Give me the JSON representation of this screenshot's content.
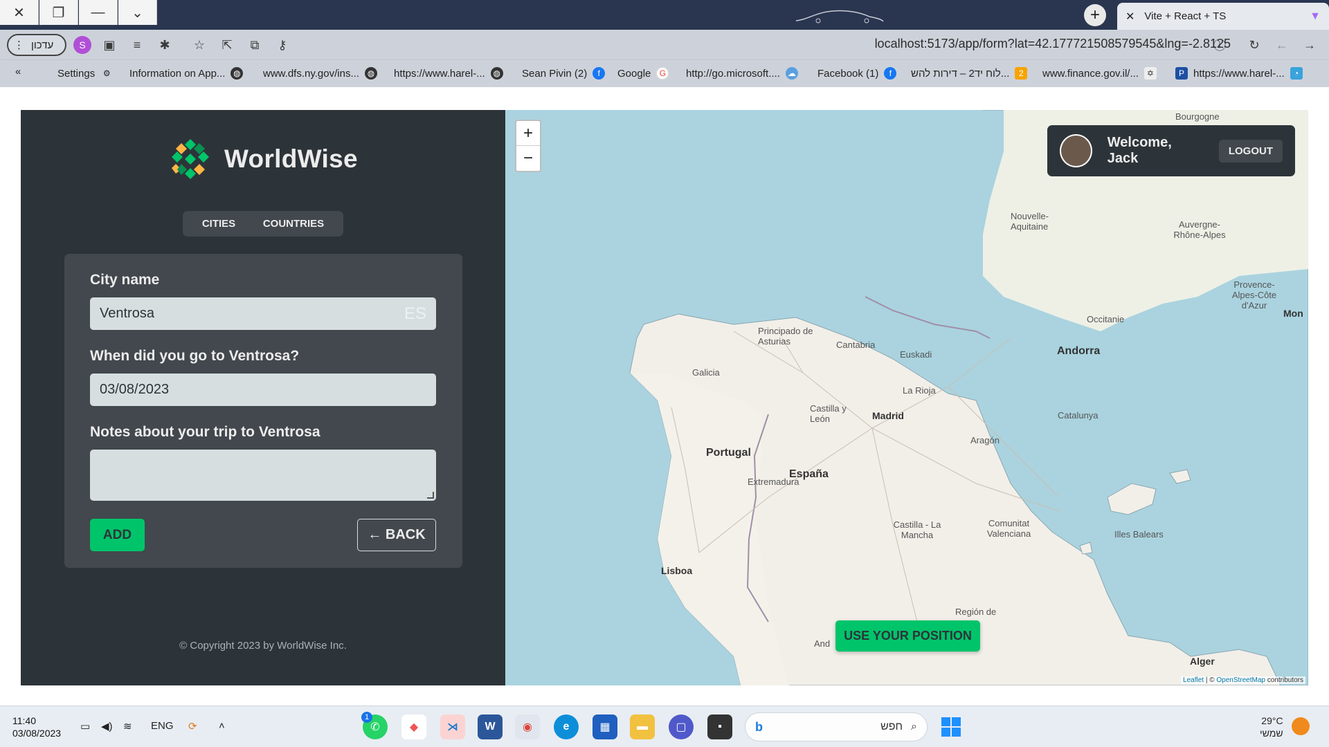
{
  "browser": {
    "window_controls": {
      "close": "✕",
      "restore": "❐",
      "minimize": "—",
      "tabs_menu": "⌄"
    },
    "tab": {
      "title": "Vite + React + TS",
      "close": "✕"
    },
    "profile_label": "עדכון",
    "avatar_letter": "S",
    "url": "localhost:5173/app/form?lat=42.177721508579545&lng=-2.8125",
    "bookmarks": [
      "Settings",
      "Information on App...",
      "www.dfs.ny.gov/ins...",
      "https://www.harel-...",
      "Sean Pivin (2)",
      "Google",
      "http://go.microsoft....",
      "Facebook (1)",
      "לוח יד2 – דירות להש...",
      "www.finance.gov.il/...",
      "https://www.harel-..."
    ]
  },
  "app": {
    "brand": "WorldWise",
    "nav": {
      "cities": "CITIES",
      "countries": "COUNTRIES"
    },
    "form": {
      "city_label": "City name",
      "city_value": "Ventrosa",
      "city_flag": "ES",
      "date_label": "When did you go to Ventrosa?",
      "date_value": "03/08/2023",
      "notes_label": "Notes about your trip to Ventrosa",
      "notes_value": "",
      "add_button": "ADD",
      "back_button": "← BACK"
    },
    "copyright": "© Copyright 2023 by WorldWise Inc."
  },
  "map": {
    "zoom_in": "+",
    "zoom_out": "−",
    "welcome": "Welcome, Jack",
    "logout": "LOGOUT",
    "use_position": "USE YOUR POSITION",
    "attribution": {
      "leaflet": "Leaflet",
      "sep": " | © ",
      "osm": "OpenStreetMap",
      "contrib": " contributors"
    },
    "labels": {
      "portugal": "Portugal",
      "espana": "España",
      "madrid": "Madrid",
      "lisboa": "Lisboa",
      "andorra": "Andorra",
      "alger": "Alger",
      "galicia": "Galicia",
      "asturias": "Principado de Asturias",
      "cantabria": "Cantabria",
      "euskadi": "Euskadi",
      "larioja": "La Rioja",
      "castillaleon": "Castilla y León",
      "aragon": "Aragón",
      "catalunya": "Catalunya",
      "extremadura": "Extremadura",
      "castillamancha": "Castilla - La Mancha",
      "valenciana": "Comunitat Valenciana",
      "baleares": "Illes Balears",
      "murcia": "Región de",
      "andalucia": "And",
      "nouvelle": "Nouvelle-Aquitaine",
      "occitanie": "Occitanie",
      "auvergne": "Auvergne-Rhône-Alpes",
      "provence": "Provence-Alpes-Côte d'Azur",
      "bourgogne": "Bourgogne",
      "mon": "Mon"
    }
  },
  "taskbar": {
    "time": "11:40",
    "date": "03/08/2023",
    "lang": "ENG",
    "search_placeholder": "חפש",
    "search_brand": "b",
    "whatsapp_badge": "1",
    "temp": "29°C",
    "weather_text": "שמשי"
  },
  "colors": {
    "sidebar": "#2d3439",
    "panel": "#42484d",
    "brand_green": "#00c46a",
    "sea": "#aad3df",
    "land": "#f2efe9"
  }
}
